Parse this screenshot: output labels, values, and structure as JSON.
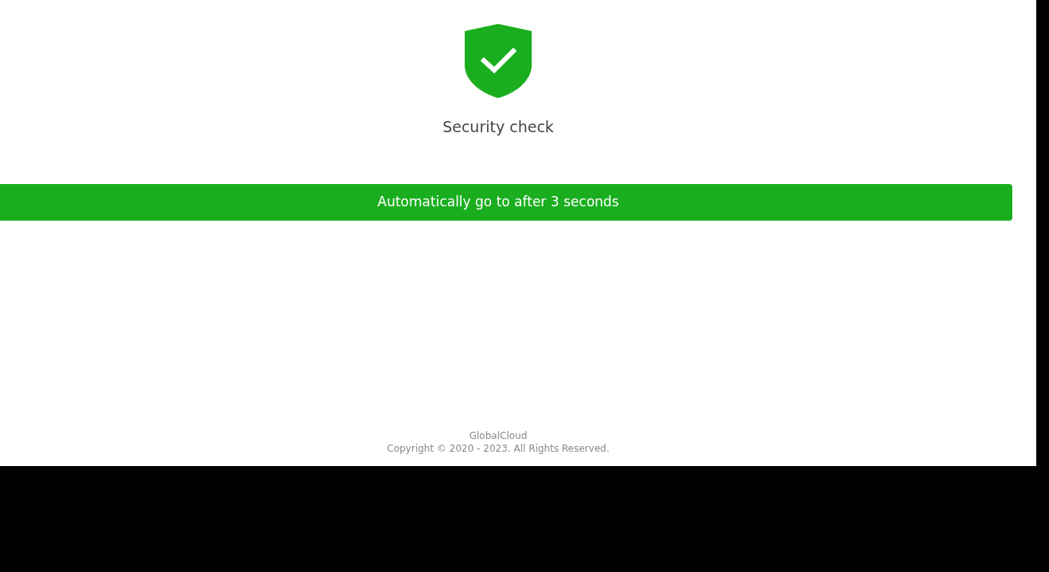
{
  "title": "Security check",
  "banner": {
    "text": "Automatically go to after 3 seconds"
  },
  "footer": {
    "brand": "GlobalCloud",
    "copyright": "Copyright © 2020 - 2023. All Rights Reserved."
  }
}
